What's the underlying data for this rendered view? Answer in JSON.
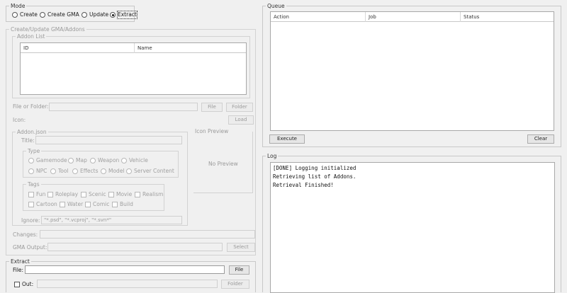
{
  "mode": {
    "title": "Mode",
    "options": [
      {
        "label": "Create",
        "selected": false
      },
      {
        "label": "Create GMA",
        "selected": false
      },
      {
        "label": "Update",
        "selected": false
      },
      {
        "label": "Extract",
        "selected": true
      }
    ]
  },
  "create_panel": {
    "title": "Create/Update GMA/Addons",
    "addon_list": {
      "title": "Addon List",
      "columns": [
        "ID",
        "Name"
      ]
    },
    "file_or_folder": {
      "label": "File or Folder:",
      "file_button": "File",
      "folder_button": "Folder"
    },
    "icon": {
      "label": "Icon:",
      "load_button": "Load"
    },
    "addon_json": {
      "title": "Addon.json",
      "title_label": "Title:",
      "type": {
        "title": "Type",
        "options": [
          "Gamemode",
          "Map",
          "Weapon",
          "Vehicle",
          "NPC",
          "Tool",
          "Effects",
          "Model",
          "Server Content"
        ]
      },
      "tags": {
        "title": "Tags",
        "options": [
          "Fun",
          "Roleplay",
          "Scenic",
          "Movie",
          "Realism",
          "Cartoon",
          "Water",
          "Comic",
          "Build"
        ]
      },
      "ignore": {
        "label": "Ignore:",
        "value": "\"*.psd\", \"*.vcproj\", \"*.svn*\""
      }
    },
    "icon_preview": {
      "title": "Icon Preview",
      "placeholder": "No Preview"
    },
    "changes": {
      "label": "Changes:"
    },
    "gma_output": {
      "label": "GMA Output:",
      "select_button": "Select"
    }
  },
  "extract_panel": {
    "title": "Extract",
    "file": {
      "label": "File:",
      "button": "File"
    },
    "out": {
      "label": "Out:",
      "button": "Folder"
    }
  },
  "queue": {
    "title": "Queue",
    "columns": [
      "Action",
      "Job",
      "Status"
    ],
    "execute_button": "Execute",
    "clear_button": "Clear"
  },
  "log": {
    "title": "Log",
    "lines": [
      "[DONE] Logging initialized",
      "Retrieving list of Addons.",
      "Retrieval Finished!"
    ]
  }
}
